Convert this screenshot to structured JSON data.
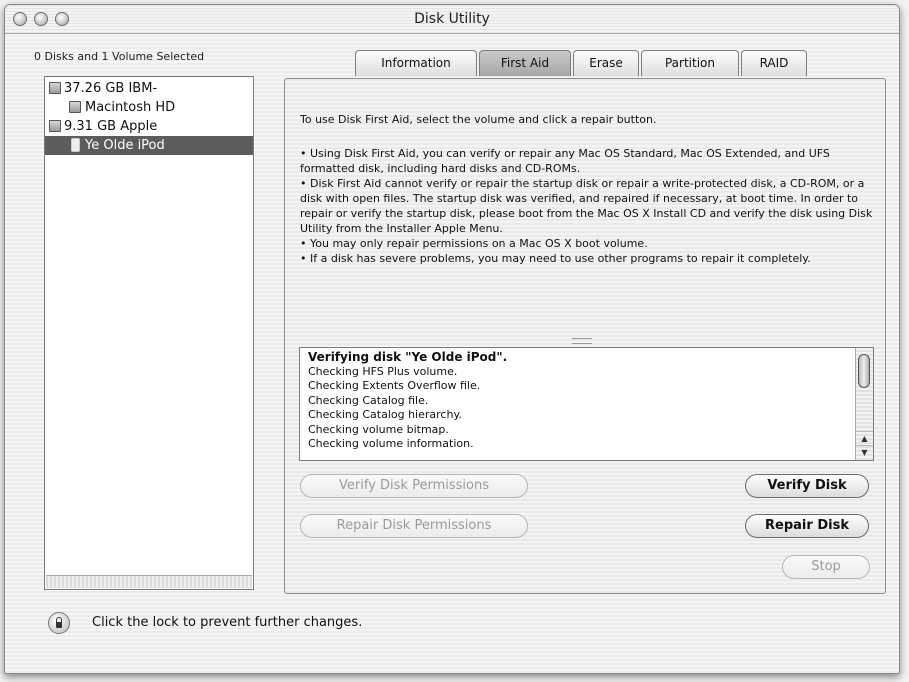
{
  "window": {
    "title": "Disk Utility"
  },
  "sidebar": {
    "header": "0 Disks and 1 Volume Selected",
    "items": [
      {
        "label": "37.26 GB IBM-",
        "icon": "hard-disk-icon",
        "level": 0,
        "selected": false
      },
      {
        "label": "Macintosh HD",
        "icon": "volume-icon",
        "level": 1,
        "selected": false
      },
      {
        "label": "9.31 GB Apple",
        "icon": "hard-disk-icon",
        "level": 0,
        "selected": false
      },
      {
        "label": "Ye Olde iPod",
        "icon": "ipod-icon",
        "level": 1,
        "selected": true
      }
    ]
  },
  "tabs": [
    {
      "label": "Information",
      "active": false
    },
    {
      "label": "First Aid",
      "active": true
    },
    {
      "label": "Erase",
      "active": false
    },
    {
      "label": "Partition",
      "active": false
    },
    {
      "label": "RAID",
      "active": false
    }
  ],
  "first_aid": {
    "instruction": "To use Disk First Aid, select the volume and click a repair button.",
    "help_lines": [
      "• Using Disk First Aid, you can verify or repair any Mac OS Standard, Mac OS Extended, and UFS formatted disk, including hard disks and CD-ROMs.",
      "• Disk First Aid cannot verify or repair the startup disk or repair a write-protected disk, a CD-ROM, or a disk with open files.  The startup disk was verified, and repaired if necessary, at boot time.  In order to repair or verify the startup disk, please boot from the Mac OS X Install CD and verify the disk using Disk Utility from the Installer Apple Menu.",
      "• You may only repair permissions on a Mac OS X boot volume.",
      "• If a disk has severe problems, you may need to use other programs to repair it completely."
    ],
    "log_lines": [
      "Verifying disk \"Ye Olde iPod\".",
      "Checking HFS Plus volume.",
      "Checking Extents Overflow file.",
      "Checking Catalog file.",
      "Checking Catalog hierarchy.",
      "Checking volume bitmap.",
      "Checking volume information."
    ],
    "buttons": {
      "verify_permissions": "Verify Disk Permissions",
      "repair_permissions": "Repair Disk Permissions",
      "verify_disk": "Verify Disk",
      "repair_disk": "Repair Disk",
      "stop": "Stop"
    }
  },
  "footer": {
    "lock_text": "Click the lock to prevent further changes."
  },
  "colors": {
    "selection": "#5c5c5c",
    "active_tab": "#b3b3b3"
  }
}
